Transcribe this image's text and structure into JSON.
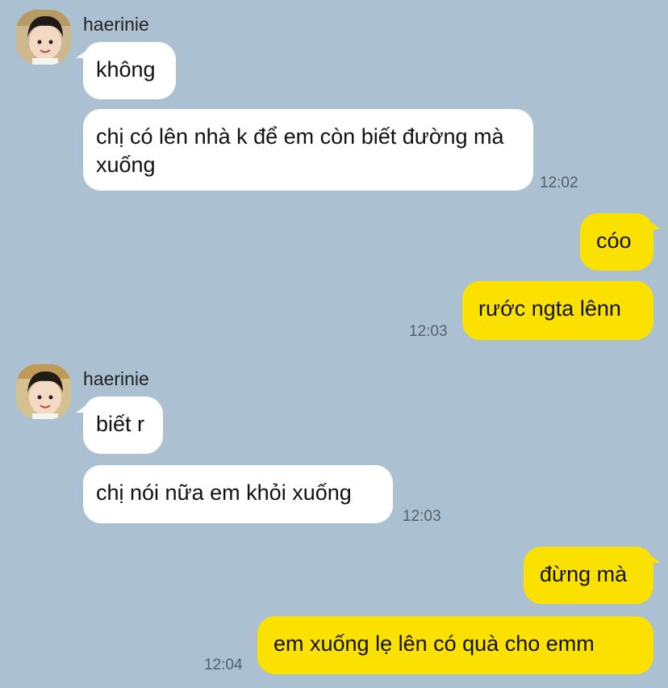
{
  "colors": {
    "background": "#abc1d1",
    "incoming": "#ffffff",
    "outgoing": "#fae100"
  },
  "groups": [
    {
      "sender": "haerinie",
      "messages": [
        "không",
        "chị có lên nhà k để em còn biết đường mà xuống"
      ],
      "time": "12:02"
    },
    {
      "sender": "me",
      "messages": [
        "cóo",
        "rước ngta lênn"
      ],
      "time": "12:03"
    },
    {
      "sender": "haerinie",
      "messages": [
        "biết r",
        "chị nói nữa em khỏi xuống"
      ],
      "time": "12:03"
    },
    {
      "sender": "me",
      "messages": [
        "đừng mà",
        "em xuống lẹ lên có quà cho emm"
      ],
      "time": "12:04"
    }
  ]
}
